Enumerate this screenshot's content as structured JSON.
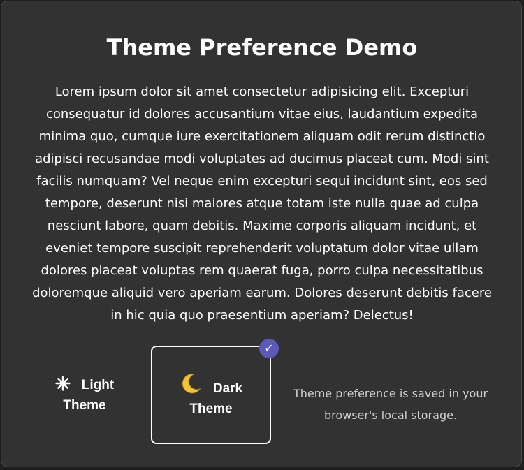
{
  "header": {
    "title": "Theme Preference Demo"
  },
  "content": {
    "paragraph": "Lorem ipsum dolor sit amet consectetur adipisicing elit. Excepturi consequatur id dolores accusantium vitae eius, laudantium expedita minima quo, cumque iure exercitationem aliquam odit rerum distinctio adipisci recusandae modi voluptates ad ducimus placeat cum. Modi sint facilis numquam? Vel neque enim excepturi sequi incidunt sint, eos sed tempore, deserunt nisi maiores atque totam iste nulla quae ad culpa nesciunt labore, quam debitis. Maxime corporis aliquam incidunt, et eveniet tempore suscipit reprehenderit voluptatum dolor vitae ullam dolores placeat voluptas rem quaerat fuga, porro culpa necessitatibus doloremque aliquid vero aperiam earum. Dolores deserunt debitis facere in hic quia quo praesentium aperiam? Delectus!"
  },
  "theme_options": [
    {
      "label": "Light Theme",
      "icon": "sun-icon",
      "selected": false
    },
    {
      "label": "Dark Theme",
      "icon": "crescent-moon-icon",
      "selected": true
    }
  ],
  "selected_badge": "✓",
  "footer_note": "Theme preference is saved in your browser's local storage.",
  "colors": {
    "card_background": "#323232",
    "text": "#ffffff",
    "muted_text": "#cfcfcf",
    "accent": "#5a5ab8",
    "moon": "#f4c430"
  }
}
